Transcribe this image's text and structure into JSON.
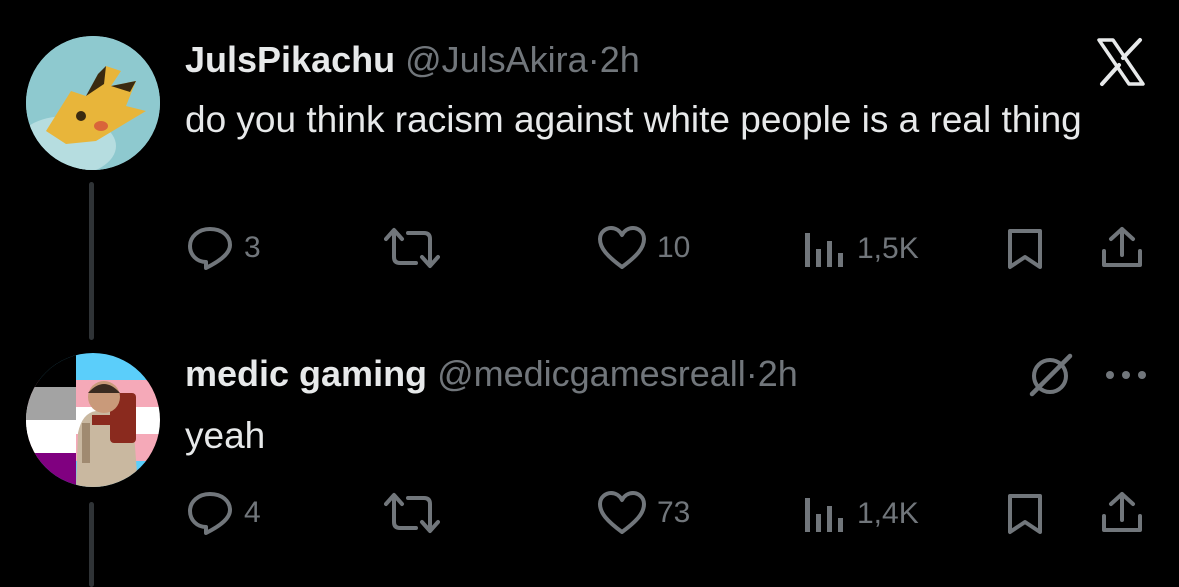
{
  "tweets": [
    {
      "name": "JulsPikachu",
      "handle": "@JulsAkira",
      "separator": "·",
      "time": "2h",
      "text": "do you think racism against white people is a real thing",
      "avatar": "pikachu-avatar",
      "replies": "3",
      "likes": "10",
      "views": "1,5K"
    },
    {
      "name": "medic gaming",
      "handle": "@medicgamesreall",
      "separator": "·",
      "time": "2h",
      "text": "yeah",
      "avatar": "medic-pride-flag-avatar",
      "replies": "4",
      "likes": "73",
      "views": "1,4K"
    }
  ],
  "icons": {
    "top_right": "x-logo-icon",
    "grok": "grok-icon",
    "more": "more-icon"
  },
  "colors": {
    "background": "#000000",
    "primary_text": "#e7e9ea",
    "secondary_text": "#71767b",
    "thread_line": "#2f3336"
  }
}
